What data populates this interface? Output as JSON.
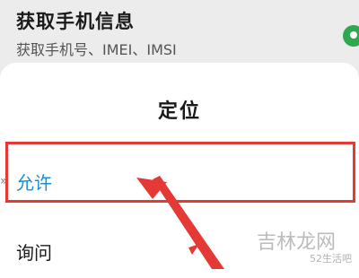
{
  "background": {
    "title": "获取手机信息",
    "subtitle": "获取手机号、IMEI、IMSI",
    "toggle_color": "#2fa84f"
  },
  "dialog": {
    "title": "定位",
    "options": [
      {
        "label": "允许",
        "selected": true,
        "color": "#1a8fd6"
      },
      {
        "label": "询问",
        "selected": false
      }
    ]
  },
  "annotation": {
    "highlight_color": "#e53935"
  },
  "watermark": {
    "main": "吉林龙网",
    "sub": "52生活吧"
  }
}
